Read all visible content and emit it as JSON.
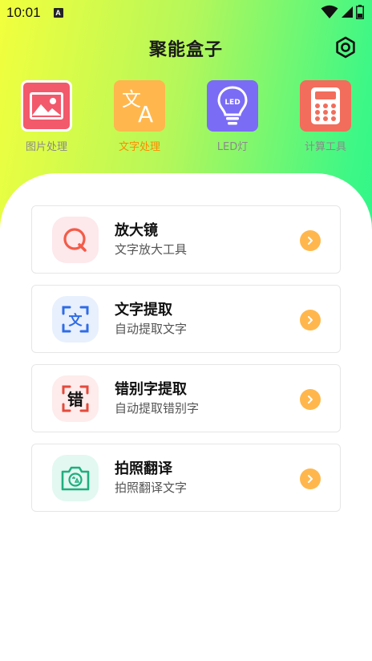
{
  "status_bar": {
    "time": "10:01",
    "notification_glyph": "A"
  },
  "header": {
    "title": "聚能盒子"
  },
  "tools": [
    {
      "label": "图片处理",
      "icon": "image-icon",
      "color": "#f2596b",
      "active": false
    },
    {
      "label": "文字处理",
      "icon": "translate-icon",
      "color": "#ffb74d",
      "active": true
    },
    {
      "label": "LED灯",
      "icon": "led-bulb-icon",
      "color": "#7b6cf6",
      "active": false
    },
    {
      "label": "计算工具",
      "icon": "calculator-icon",
      "color": "#f26d5b",
      "active": false
    }
  ],
  "led_icon_text": "LED",
  "menu": [
    {
      "title": "放大镜",
      "subtitle": "文字放大工具",
      "icon": "magnifier-icon",
      "bg": "#fde8ec",
      "accent": "#f35c48"
    },
    {
      "title": "文字提取",
      "subtitle": "自动提取文字",
      "icon": "text-scan-icon",
      "bg": "#e8f0fe",
      "accent": "#2f6ce5",
      "glyph": "文"
    },
    {
      "title": "错别字提取",
      "subtitle": "自动提取错别字",
      "icon": "typo-scan-icon",
      "bg": "#fdeceb",
      "accent": "#e34a3c",
      "glyph": "错"
    },
    {
      "title": "拍照翻译",
      "subtitle": "拍照翻译文字",
      "icon": "camera-translate-icon",
      "bg": "#e2f8f1",
      "accent": "#1fae7e"
    }
  ],
  "colors": {
    "accent_orange": "#ff8a00",
    "chevron": "#ffb74d"
  }
}
